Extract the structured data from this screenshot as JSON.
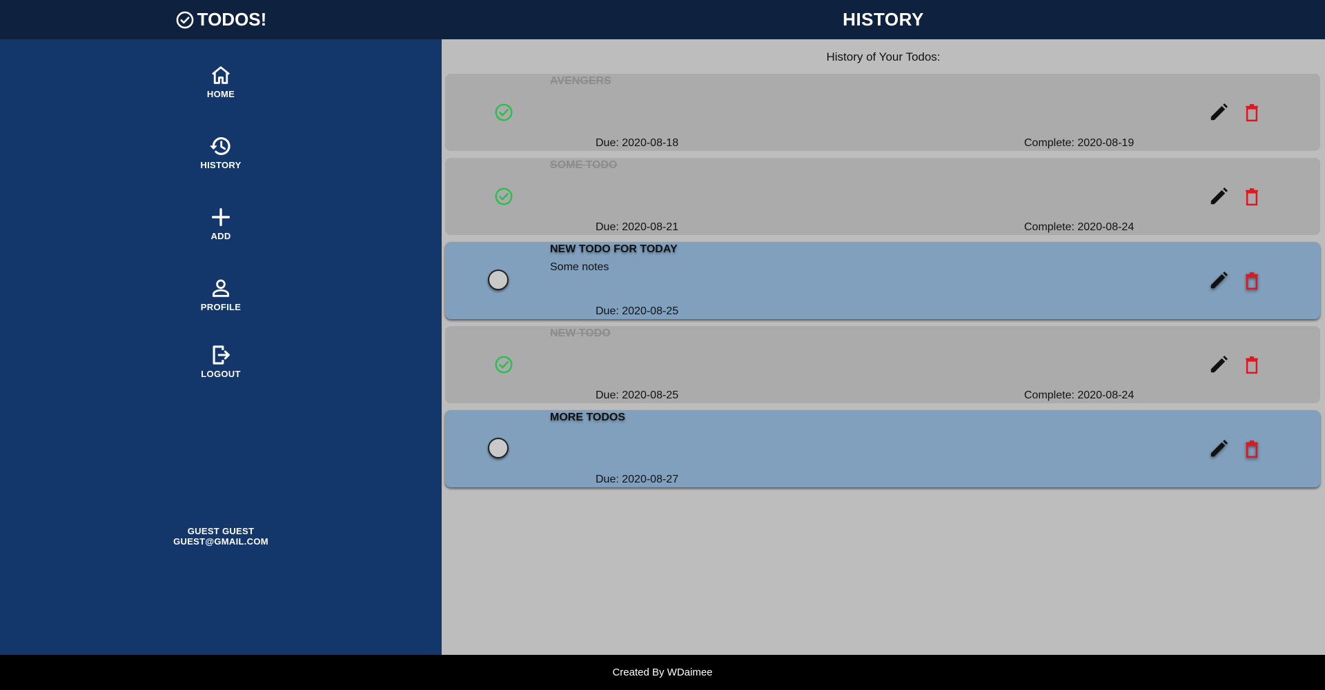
{
  "app": {
    "name": "TODOS!",
    "logo_icon": "check-circle-outline-icon"
  },
  "header": {
    "title": "HISTORY"
  },
  "sidebar": {
    "items": [
      {
        "label": "HOME",
        "icon": "home-icon"
      },
      {
        "label": "HISTORY",
        "icon": "history-icon"
      },
      {
        "label": "ADD",
        "icon": "plus-icon"
      },
      {
        "label": "PROFILE",
        "icon": "person-icon"
      },
      {
        "label": "LOGOUT",
        "icon": "logout-icon"
      }
    ],
    "user": {
      "name": "GUEST GUEST",
      "email": "GUEST@GMAIL.COM"
    }
  },
  "main": {
    "heading": "History of Your Todos:",
    "todos": [
      {
        "title": "AVENGERS",
        "notes": "",
        "due": "Due: 2020-08-18",
        "complete": "Complete: 2020-08-19",
        "completed": true
      },
      {
        "title": "SOME TODO",
        "notes": "",
        "due": "Due: 2020-08-21",
        "complete": "Complete: 2020-08-24",
        "completed": true
      },
      {
        "title": "NEW TODO FOR TODAY",
        "notes": "Some notes",
        "due": "Due: 2020-08-25",
        "complete": "",
        "completed": false
      },
      {
        "title": "NEW TODO",
        "notes": "",
        "due": "Due: 2020-08-25",
        "complete": "Complete: 2020-08-24",
        "completed": true
      },
      {
        "title": "MORE TODOS",
        "notes": "",
        "due": "Due: 2020-08-27",
        "complete": "",
        "completed": false
      }
    ]
  },
  "footer": {
    "text": "Created By WDaimee"
  },
  "colors": {
    "topbar": "#0e213f",
    "sidebar": "#14376b",
    "main_bg": "#bdbdbd",
    "completed_card": "#ababab",
    "active_card": "#81a0bd",
    "check_green": "#2ebd4e",
    "delete_red": "#e3141c",
    "footer": "#000000"
  }
}
